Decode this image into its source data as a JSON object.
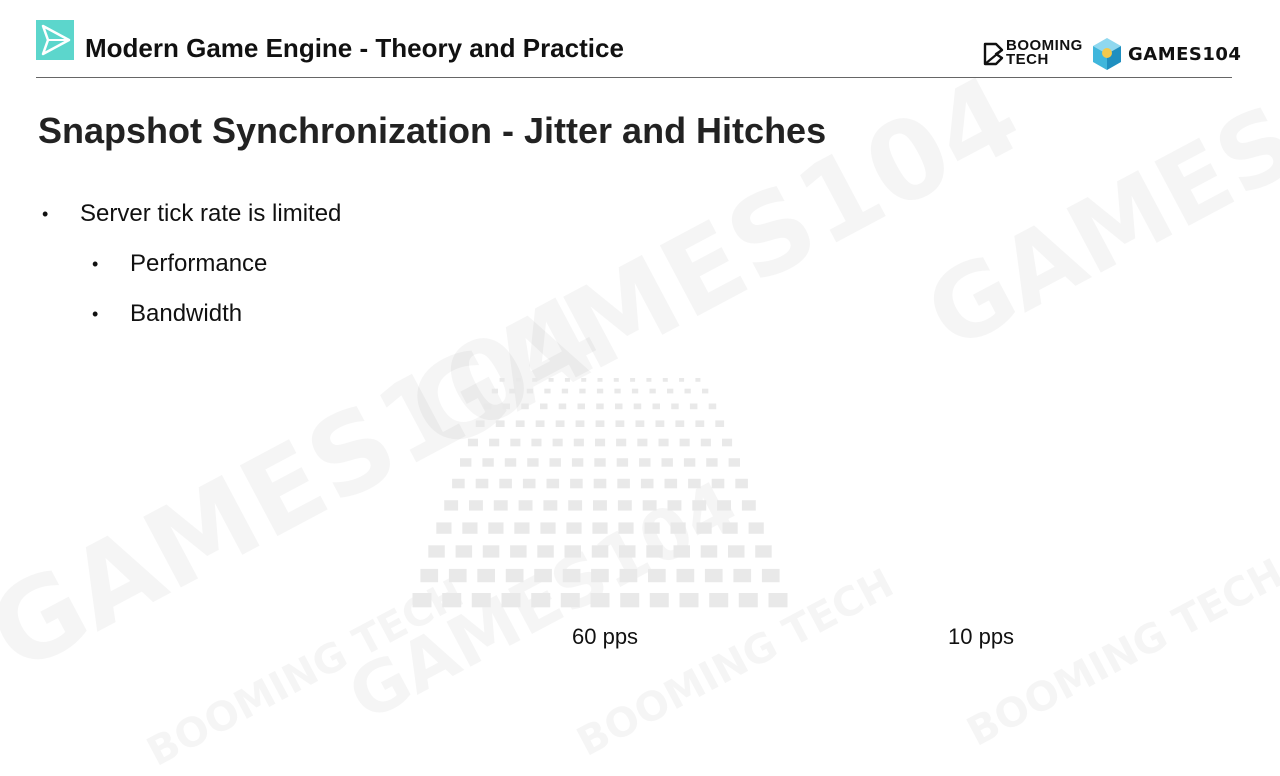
{
  "header": {
    "title": "Modern Game Engine - Theory and Practice",
    "logos": {
      "booming_line1": "BOOMING",
      "booming_line2": "TECH",
      "games": "GAMES104"
    }
  },
  "slide": {
    "title": "Snapshot Synchronization - Jitter and Hitches",
    "bullets": [
      {
        "text": "Server tick rate is limited",
        "children": [
          "Performance",
          "Bandwidth"
        ]
      }
    ],
    "captions": [
      "60 pps",
      "10 pps"
    ]
  },
  "colors": {
    "accent": "#5cd6cc",
    "title_text": "#222222",
    "rule": "#666666"
  },
  "watermark": {
    "text": "GAMES104",
    "brand": "BOOMING TECH"
  }
}
